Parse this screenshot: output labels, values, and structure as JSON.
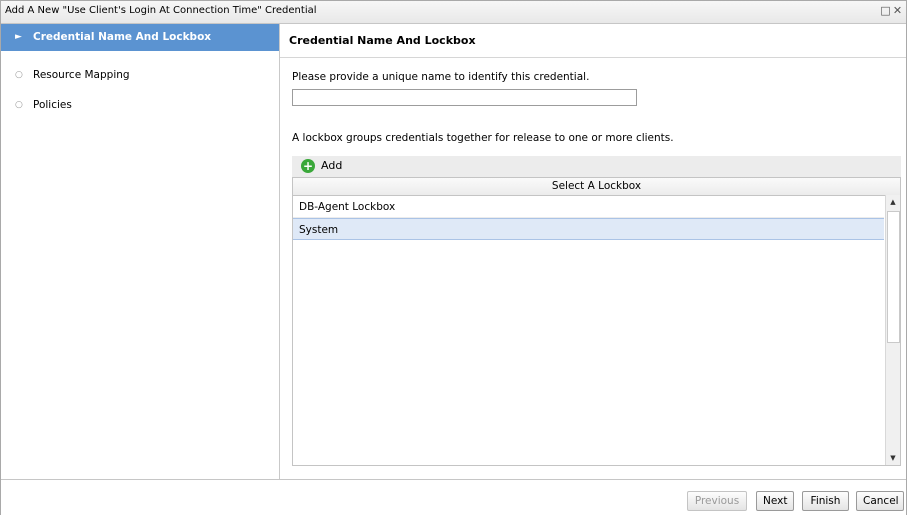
{
  "window": {
    "title": "Add A New \"Use Client's Login At Connection Time\" Credential",
    "maximize_icon": "□",
    "close_icon": "✕"
  },
  "sidebar": {
    "items": [
      {
        "label": "Credential Name And Lockbox",
        "bullet": "►",
        "active": true
      },
      {
        "label": "Resource Mapping",
        "bullet": "○",
        "active": false
      },
      {
        "label": "Policies",
        "bullet": "○",
        "active": false
      }
    ]
  },
  "content": {
    "header": "Credential Name And Lockbox",
    "name_prompt": "Please provide a unique name to identify this credential.",
    "name_value": "",
    "lockbox_prompt": "A lockbox groups credentials together for release to one or more clients.",
    "add_label": "Add",
    "add_icon": "+",
    "grid_header": "Select A Lockbox",
    "rows": [
      {
        "label": "DB-Agent Lockbox",
        "selected": false
      },
      {
        "label": "System",
        "selected": true
      }
    ]
  },
  "footer": {
    "previous": "Previous",
    "next": "Next",
    "finish": "Finish",
    "cancel": "Cancel"
  },
  "colors": {
    "active_nav": "#5b93d1",
    "selected_row": "#dfe9f7",
    "add_icon": "#3aa83a"
  }
}
